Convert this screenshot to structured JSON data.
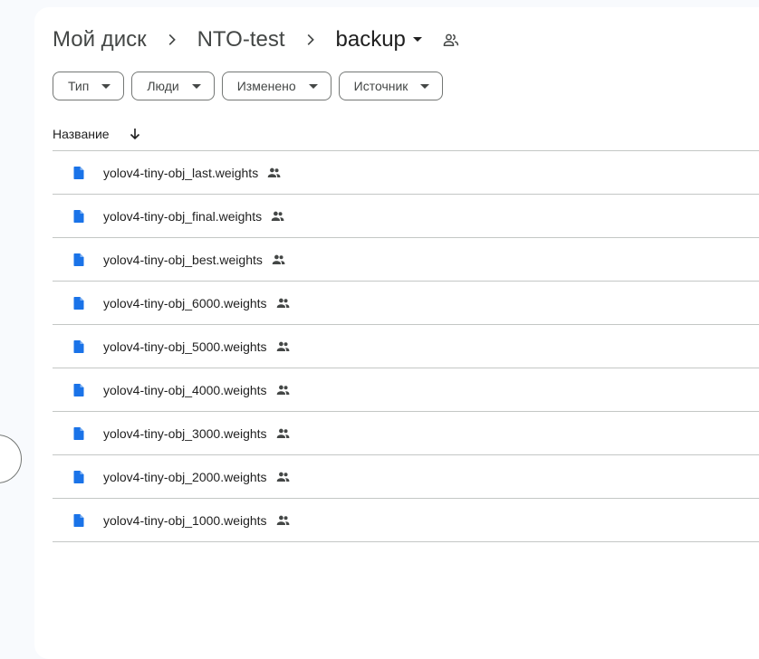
{
  "breadcrumb": {
    "root": "Мой диск",
    "parent": "NTO-test",
    "current": "backup",
    "current_shared_icon": "people-outline-icon"
  },
  "filters": [
    {
      "label": "Тип"
    },
    {
      "label": "Люди"
    },
    {
      "label": "Изменено"
    },
    {
      "label": "Источник"
    }
  ],
  "list": {
    "column_name": "Название",
    "sort_icon": "arrow-down-icon",
    "file_icon": "doc-file-icon",
    "shared_icon": "people-icon",
    "file_icon_color": "#1a73e8",
    "files": [
      {
        "name": "yolov4-tiny-obj_last.weights"
      },
      {
        "name": "yolov4-tiny-obj_final.weights"
      },
      {
        "name": "yolov4-tiny-obj_best.weights"
      },
      {
        "name": "yolov4-tiny-obj_6000.weights"
      },
      {
        "name": "yolov4-tiny-obj_5000.weights"
      },
      {
        "name": "yolov4-tiny-obj_4000.weights"
      },
      {
        "name": "yolov4-tiny-obj_3000.weights"
      },
      {
        "name": "yolov4-tiny-obj_2000.weights"
      },
      {
        "name": "yolov4-tiny-obj_1000.weights"
      }
    ]
  }
}
